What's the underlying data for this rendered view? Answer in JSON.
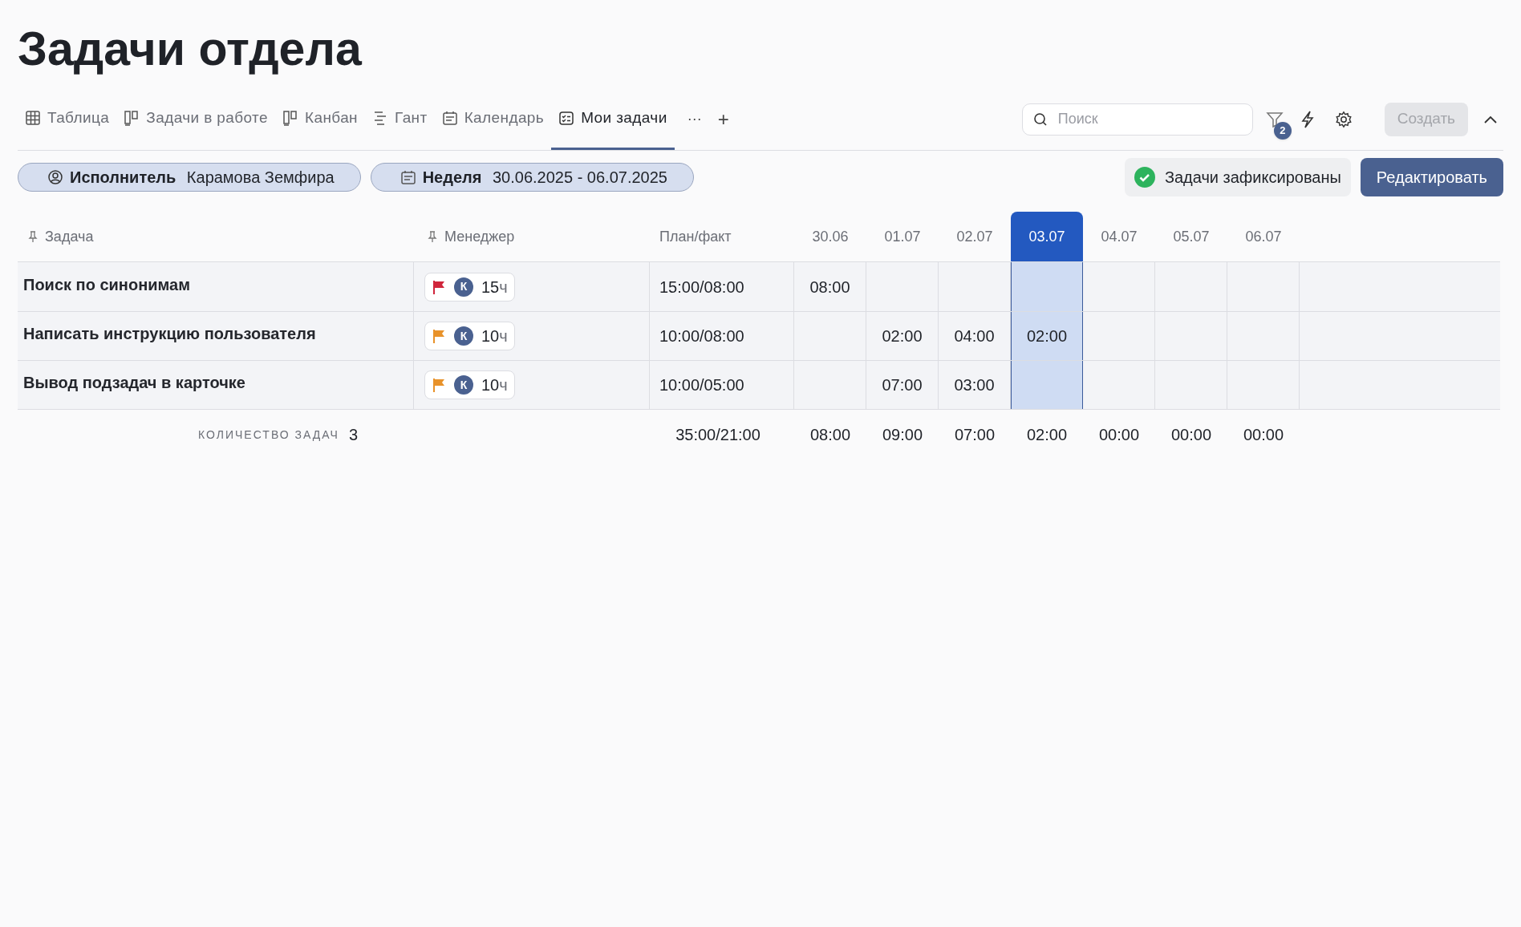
{
  "title": "Задачи отдела",
  "tabs": [
    {
      "label": "Таблица",
      "kind": "grid",
      "selected": false
    },
    {
      "label": "Задачи в работе",
      "kind": "columns",
      "selected": false
    },
    {
      "label": "Канбан",
      "kind": "columns",
      "selected": false
    },
    {
      "label": "Гант",
      "kind": "gantt",
      "selected": false
    },
    {
      "label": "Календарь",
      "kind": "calendar",
      "selected": false
    },
    {
      "label": "Мои задачи",
      "kind": "checklist",
      "selected": true
    }
  ],
  "more": "···",
  "add": "+",
  "search": {
    "placeholder": "Поиск"
  },
  "filter_badge": "2",
  "create_button": {
    "label": "Создать",
    "disabled": true
  },
  "filters": [
    {
      "kind": "user",
      "label": "Исполнитель",
      "value": "Карамова Земфира"
    },
    {
      "kind": "calendar",
      "label": "Неделя",
      "value": "30.06.2025 - 06.07.2025"
    }
  ],
  "status": "Задачи зафиксированы",
  "edit_button": "Редактировать",
  "table": {
    "columns": {
      "task": "Задача",
      "manager": "Менеджер",
      "plan": "План/факт",
      "days": [
        {
          "label": "30.06",
          "selected": false
        },
        {
          "label": "01.07",
          "selected": false
        },
        {
          "label": "02.07",
          "selected": false
        },
        {
          "label": "03.07",
          "selected": true
        },
        {
          "label": "04.07",
          "selected": false
        },
        {
          "label": "05.07",
          "selected": false
        },
        {
          "label": "06.07",
          "selected": false
        }
      ]
    },
    "rows": [
      {
        "task": "Поиск по синонимам",
        "color": "#d0263c",
        "avatar": "К",
        "hours": "15",
        "unit": "ч",
        "plan": "15:00/08:00",
        "days": {
          "day_1": "08:00"
        }
      },
      {
        "task": "Написать инструкцию пользователя",
        "color": "#e8922a",
        "avatar": "К",
        "hours": "10",
        "unit": "ч",
        "plan": "10:00/08:00",
        "days": {
          "day_2": "02:00",
          "day_3": "04:00",
          "day_4": "02:00"
        }
      },
      {
        "task": "Вывод подзадач в карточке",
        "color": "#e8922a",
        "avatar": "К",
        "hours": "10",
        "unit": "ч",
        "plan": "10:00/05:00",
        "days": {
          "day_2": "07:00",
          "day_3": "03:00"
        }
      }
    ],
    "summary": {
      "label": "КОЛИЧЕСТВО ЗАДАЧ",
      "count": "3",
      "plan": "35:00/21:00",
      "days": [
        "08:00",
        "09:00",
        "07:00",
        "02:00",
        "00:00",
        "00:00",
        "00:00"
      ]
    }
  }
}
